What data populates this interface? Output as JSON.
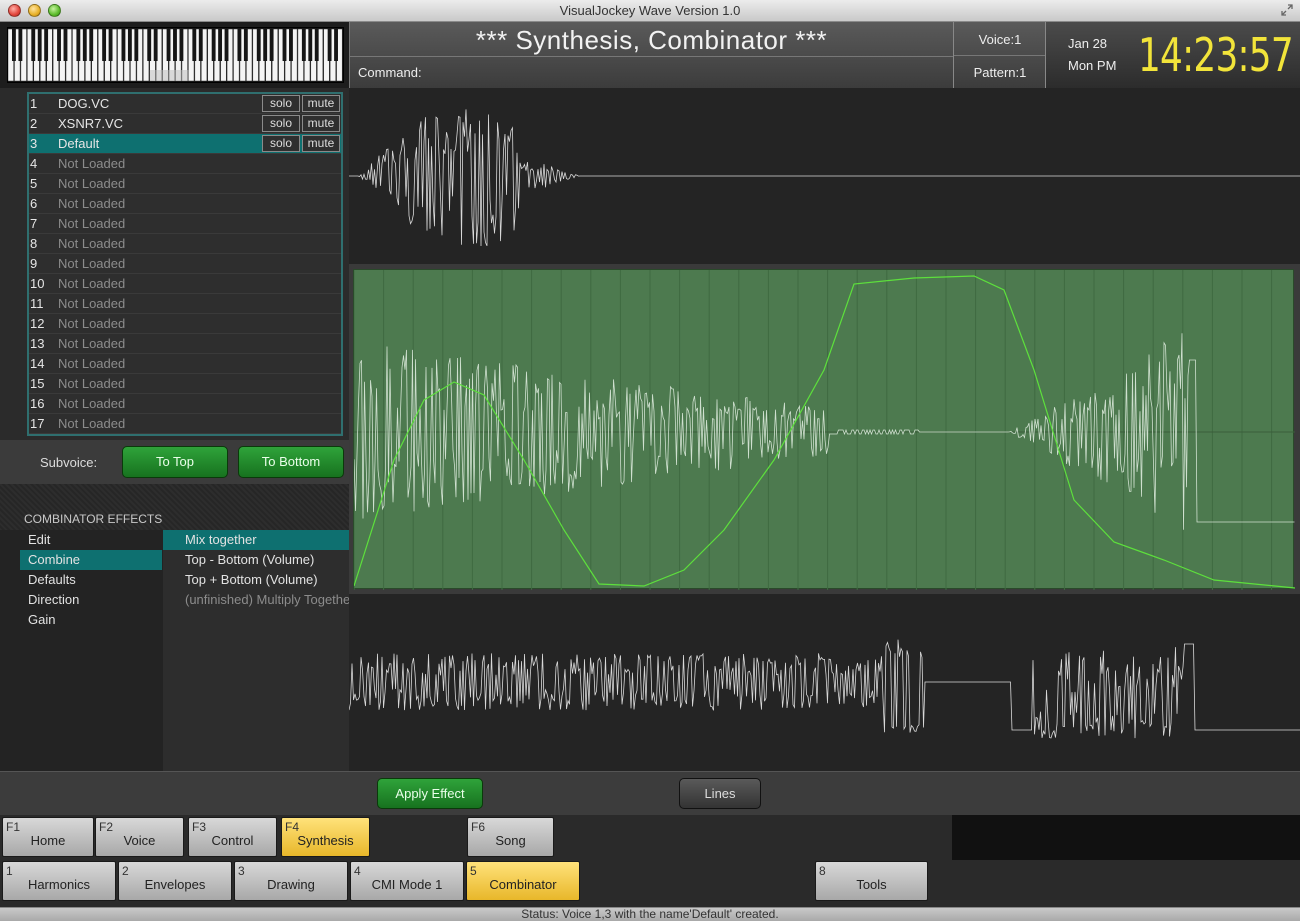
{
  "window": {
    "title": "VisualJockey Wave Version 1.0"
  },
  "header": {
    "screen_title": "*** Synthesis, Combinator ***",
    "command_label": "Command:",
    "voice": "Voice:1",
    "pattern": "Pattern:1",
    "date": "Jan 28",
    "day": "Mon PM",
    "time": "14:23:57"
  },
  "voices": [
    {
      "num": "1",
      "name": "DOG.VC",
      "solo": "solo",
      "mute": "mute"
    },
    {
      "num": "2",
      "name": "XSNR7.VC",
      "solo": "solo",
      "mute": "mute"
    },
    {
      "num": "3",
      "name": "Default",
      "solo": "solo",
      "mute": "mute"
    },
    {
      "num": "4",
      "name": "Not Loaded"
    },
    {
      "num": "5",
      "name": "Not Loaded"
    },
    {
      "num": "6",
      "name": "Not Loaded"
    },
    {
      "num": "7",
      "name": "Not Loaded"
    },
    {
      "num": "8",
      "name": "Not Loaded"
    },
    {
      "num": "9",
      "name": "Not Loaded"
    },
    {
      "num": "10",
      "name": "Not Loaded"
    },
    {
      "num": "11",
      "name": "Not Loaded"
    },
    {
      "num": "12",
      "name": "Not Loaded"
    },
    {
      "num": "13",
      "name": "Not Loaded"
    },
    {
      "num": "14",
      "name": "Not Loaded"
    },
    {
      "num": "15",
      "name": "Not Loaded"
    },
    {
      "num": "16",
      "name": "Not Loaded"
    },
    {
      "num": "17",
      "name": "Not Loaded"
    }
  ],
  "selected_voice": "3",
  "subvoice": {
    "label": "Subvoice:",
    "to_top": "To Top",
    "to_bottom": "To Bottom"
  },
  "effects": {
    "heading": "COMBINATOR EFFECTS",
    "categories": [
      "Edit",
      "Combine",
      "Defaults",
      "Direction",
      "Gain"
    ],
    "selected_category": "Combine",
    "options": [
      "Mix together",
      "Top - Bottom (Volume)",
      "Top + Bottom (Volume)",
      "(unfinished)   Multiply Together"
    ],
    "selected_option": "Mix together"
  },
  "actions": {
    "apply": "Apply Effect",
    "lines": "Lines"
  },
  "function_keys": [
    {
      "key": "F1",
      "label": "Home"
    },
    {
      "key": "F2",
      "label": "Voice"
    },
    {
      "key": "F3",
      "label": "Control"
    },
    {
      "key": "F4",
      "label": "Synthesis"
    },
    {
      "key": "F6",
      "label": "Song"
    }
  ],
  "sub_keys": [
    {
      "key": "1",
      "label": "Harmonics"
    },
    {
      "key": "2",
      "label": "Envelopes"
    },
    {
      "key": "3",
      "label": "Drawing"
    },
    {
      "key": "4",
      "label": "CMI Mode 1"
    },
    {
      "key": "5",
      "label": "Combinator"
    },
    {
      "key": "8",
      "label": "Tools"
    }
  ],
  "active_function_key": "F4",
  "active_sub_key": "5",
  "status": "Status: Voice 1,3 with the name'Default' created.",
  "colors": {
    "accent_teal": "#0e7070",
    "active_key": "#f5cc44",
    "clock": "#f2e43a",
    "green_button": "#23893a",
    "waveform_bg": "#4d7a4f",
    "envelope": "#58d23c"
  }
}
